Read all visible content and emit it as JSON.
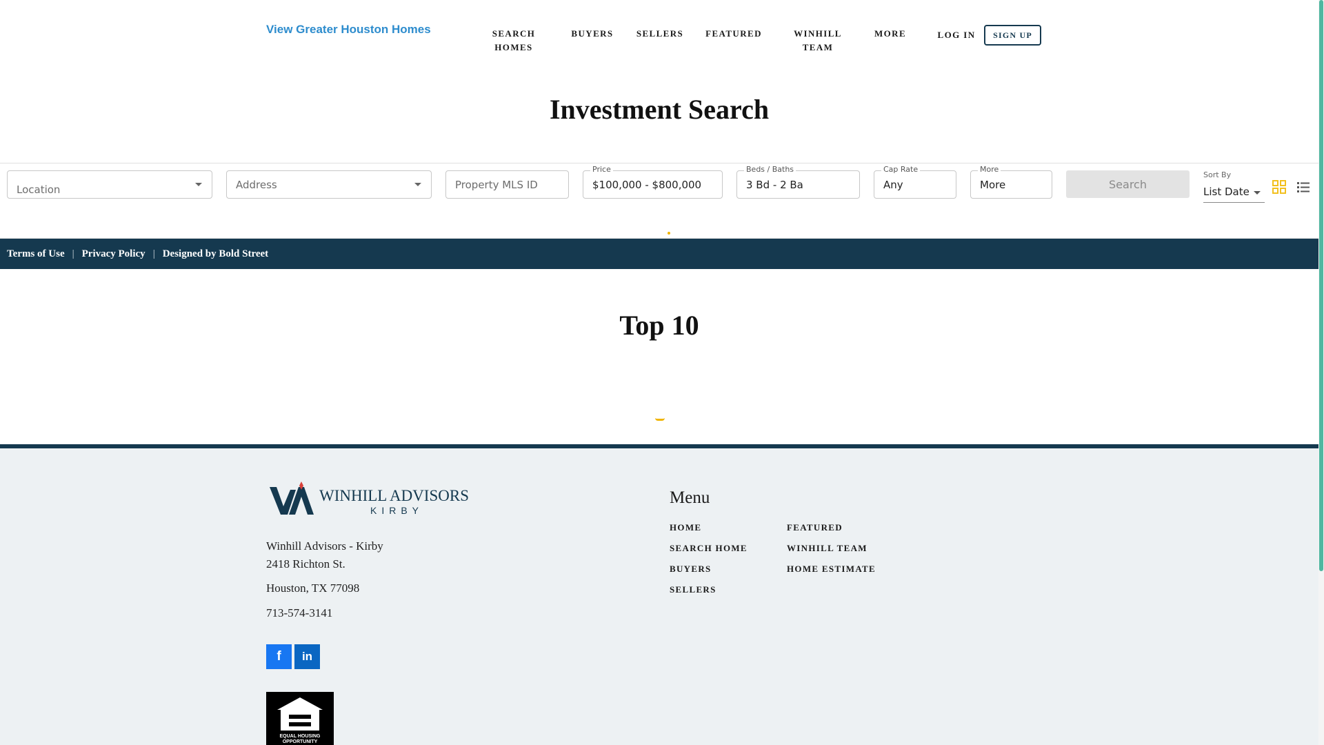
{
  "header": {
    "brand": "View Greater Houston Homes",
    "nav": [
      {
        "line1": "SEARCH",
        "line2": "HOMES"
      },
      {
        "line1": "BUYERS",
        "line2": ""
      },
      {
        "line1": "SELLERS",
        "line2": ""
      },
      {
        "line1": "FEATURED",
        "line2": ""
      },
      {
        "line1": "WINHILL",
        "line2": "TEAM"
      },
      {
        "line1": "MORE",
        "line2": ""
      }
    ],
    "login": "LOG IN",
    "signup": "SIGN UP"
  },
  "page_title": "Investment Search",
  "search": {
    "location_placeholder": "Location",
    "address_placeholder": "Address",
    "mls_placeholder": "Property MLS ID",
    "price_label": "Price",
    "price_value": "$100,000 - $800,000",
    "beds_label": "Beds / Baths",
    "beds_value": "3 Bd - 2 Ba",
    "cap_label": "Cap Rate",
    "cap_value": "Any",
    "more_label": "More",
    "more_value": "More",
    "search_button": "Search",
    "sort_label": "Sort By",
    "sort_value": "List Date",
    "icons": {
      "grid": "grid-view-icon",
      "list": "list-view-icon"
    },
    "colors": {
      "view_icon": "#f2c01e"
    }
  },
  "legal": {
    "terms": "Terms of Use",
    "sep": "|",
    "privacy": "Privacy Policy",
    "designed": "Designed by Bold Street"
  },
  "section_title": "Top 10",
  "footer": {
    "logo_text": "WINHILL ADVISORS",
    "logo_sub": "KIRBY",
    "office": "Winhill Advisors - Kirby",
    "street": "2418 Richton St.",
    "city": "Houston, TX 77098",
    "phone": "713-574-3141",
    "social": {
      "facebook": "f",
      "linkedin": "in"
    },
    "eho_line1": "EQUAL HOUSING",
    "eho_line2": "OPPORTUNITY",
    "menu_title": "Menu",
    "menu_col1": [
      "HOME",
      "SEARCH HOME",
      "BUYERS",
      "SELLERS"
    ],
    "menu_col2": [
      "FEATURED",
      "WINHILL TEAM",
      "HOME ESTIMATE"
    ]
  },
  "colors": {
    "brand_blue": "#2d8ccd",
    "navy": "#15394f",
    "accent_yellow": "#f0b400",
    "facebook": "#1877f2",
    "linkedin": "#0a66c2",
    "footer_bg": "#edf1f3"
  }
}
